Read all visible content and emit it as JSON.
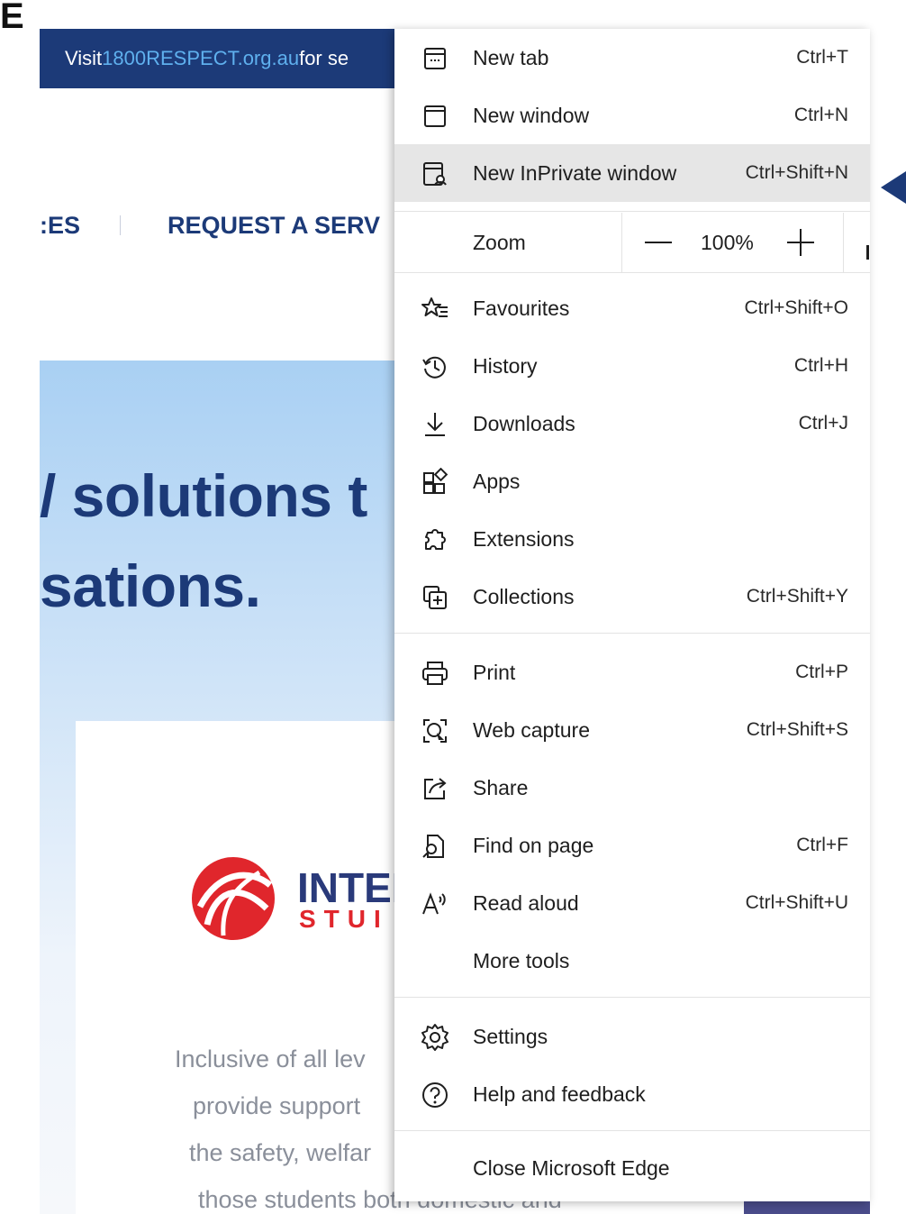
{
  "page": {
    "corner_glyph": "E",
    "banner": {
      "visit": "Visit ",
      "link": "1800RESPECT.org.au",
      "rest": " for se"
    },
    "nav": {
      "left_fragment": ":ES",
      "request": "REQUEST A SERV"
    },
    "hero": {
      "line1": "/ solutions t",
      "line2": "sations."
    },
    "logo": {
      "name": "INTEI",
      "sub": "STUI",
      "colors": {
        "red": "#e0262c",
        "navy": "#2a3a7a"
      }
    },
    "body_lines": [
      "Inclusive of all lev",
      "provide support",
      "the safety, welfar",
      "those students both domestic and"
    ],
    "brand_color": "#1c3a78"
  },
  "menu": {
    "items_top": [
      {
        "id": "new-tab",
        "icon": "new-tab-icon",
        "label": "New tab",
        "shortcut": "Ctrl+T"
      },
      {
        "id": "new-window",
        "icon": "new-window-icon",
        "label": "New window",
        "shortcut": "Ctrl+N"
      },
      {
        "id": "new-inprivate-window",
        "icon": "inprivate-window-icon",
        "label": "New InPrivate window",
        "shortcut": "Ctrl+Shift+N",
        "highlighted": true
      }
    ],
    "zoom": {
      "label": "Zoom",
      "value": "100%"
    },
    "items_mid": [
      {
        "id": "favourites",
        "icon": "favourites-icon",
        "label": "Favourites",
        "shortcut": "Ctrl+Shift+O"
      },
      {
        "id": "history",
        "icon": "history-icon",
        "label": "History",
        "shortcut": "Ctrl+H"
      },
      {
        "id": "downloads",
        "icon": "downloads-icon",
        "label": "Downloads",
        "shortcut": "Ctrl+J"
      },
      {
        "id": "apps",
        "icon": "apps-icon",
        "label": "Apps",
        "shortcut": ""
      },
      {
        "id": "extensions",
        "icon": "extensions-icon",
        "label": "Extensions",
        "shortcut": ""
      },
      {
        "id": "collections",
        "icon": "collections-icon",
        "label": "Collections",
        "shortcut": "Ctrl+Shift+Y"
      }
    ],
    "items_tools": [
      {
        "id": "print",
        "icon": "print-icon",
        "label": "Print",
        "shortcut": "Ctrl+P"
      },
      {
        "id": "web-capture",
        "icon": "web-capture-icon",
        "label": "Web capture",
        "shortcut": "Ctrl+Shift+S"
      },
      {
        "id": "share",
        "icon": "share-icon",
        "label": "Share",
        "shortcut": ""
      },
      {
        "id": "find-on-page",
        "icon": "find-icon",
        "label": "Find on page",
        "shortcut": "Ctrl+F"
      },
      {
        "id": "read-aloud",
        "icon": "read-aloud-icon",
        "label": "Read aloud",
        "shortcut": "Ctrl+Shift+U"
      },
      {
        "id": "more-tools",
        "icon": "",
        "label": "More tools",
        "shortcut": ""
      }
    ],
    "items_bottom": [
      {
        "id": "settings",
        "icon": "settings-icon",
        "label": "Settings",
        "shortcut": ""
      },
      {
        "id": "help-and-feedback",
        "icon": "help-icon",
        "label": "Help and feedback",
        "shortcut": ""
      }
    ],
    "close": {
      "label": "Close Microsoft Edge"
    },
    "colors": {
      "hover": "#e6e6e6",
      "text": "#1e1e1e",
      "divider": "#e3e3e3"
    }
  }
}
